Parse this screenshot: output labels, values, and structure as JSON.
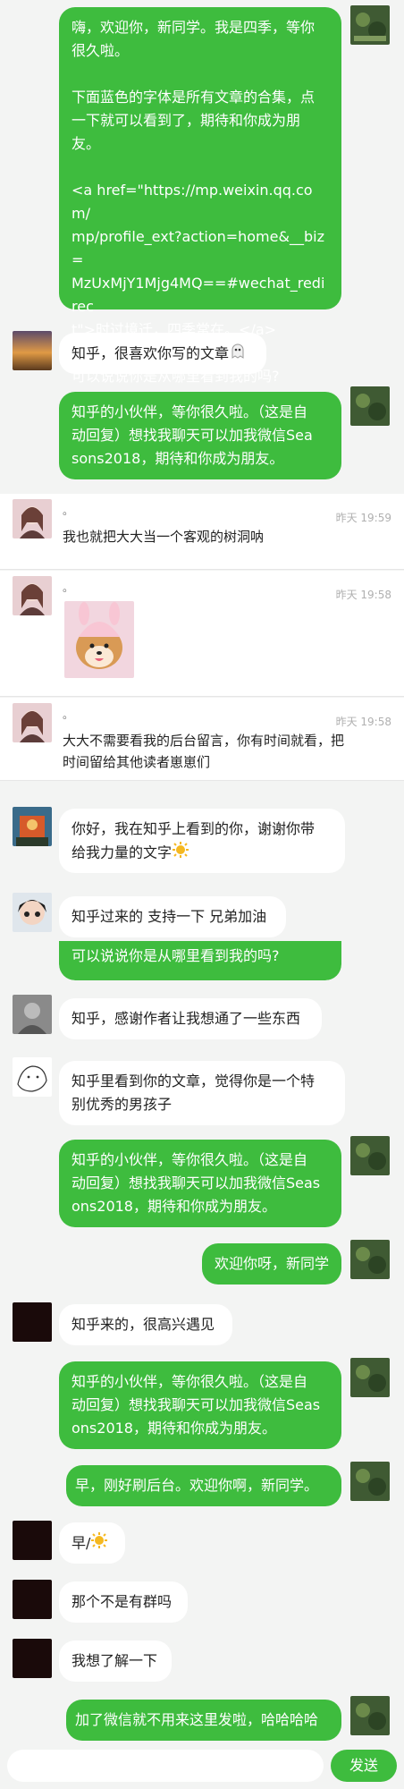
{
  "conversation": {
    "bubble1": {
      "line1": "嗨，欢迎你，新同学。我是四季，等你",
      "line2": "很久啦。",
      "line3": "下面蓝色的字体是所有文章的合集，点",
      "line4": "一下就可以看到了，期待和你成为朋",
      "line5": "友。",
      "line6": "<a href=\"https://mp.weixin.qq.com/",
      "line7": "mp/profile_ext?action=home&__biz=",
      "line8": "MzUxMjY1Mjg4MQ==#wechat_redirec",
      "line9": "t\">时过境迁，四季常在。</a>",
      "line10": "可以说说你是从哪里看到我的吗?"
    },
    "msg_zhihu_like": "知乎，很喜欢你写的文章",
    "auto_reply_1": {
      "line1": "知乎的小伙伴，等你很久啦。（这是自",
      "line2": "动回复）想找我聊天可以加我微信Sea",
      "line3": "sons2018，期待和你成为朋友。"
    },
    "comments": [
      {
        "dot": "。",
        "time": "昨天 19:59",
        "text": "我也就把大大当一个客观的树洞呐"
      },
      {
        "dot": "。",
        "time": "昨天 19:58"
      },
      {
        "dot": "。",
        "time": "昨天 19:58",
        "text1": "大大不需要看我的后台留言，你有时间就看，把",
        "text2": "时间留给其他读者崽崽们"
      }
    ],
    "msg_power": {
      "line1": "你好，我在知乎上看到的你，谢谢你带",
      "line2": "给我力量的文字"
    },
    "msg_support": "知乎过来的 支持一下 兄弟加油",
    "msg_partial": "可以说说你是从哪里看到我的吗?",
    "msg_thanks": "知乎，感谢作者让我想通了一些东西",
    "msg_outstanding": {
      "line1": "知乎里看到你的文章，觉得你是一个特",
      "line2": "别优秀的男孩子"
    },
    "auto_reply_2": {
      "line1": "知乎的小伙伴，等你很久啦。（这是自",
      "line2": "动回复）想找我聊天可以加我微信Seas",
      "line3": "ons2018，期待和你成为朋友。"
    },
    "msg_welcome": "欢迎你呀，新同学",
    "msg_happy": "知乎来的，很高兴遇见",
    "auto_reply_3": {
      "line1": "知乎的小伙伴，等你很久啦。（这是自",
      "line2": "动回复）想找我聊天可以加我微信Seas",
      "line3": "ons2018，期待和你成为朋友。"
    },
    "msg_early": "早，刚好刷后台。欢迎你啊，新同学。",
    "msg_morning": "早/",
    "msg_group": "那个不是有群吗",
    "msg_understand": "我想了解一下",
    "msg_wechat": "加了微信就不用来这里发啦，哈哈哈哈"
  },
  "input": {
    "placeholder": "",
    "send_label": "发送"
  },
  "colors": {
    "green": "#3ebc3e",
    "bg": "#f3f4f3"
  },
  "icons": [
    "plant-avatar",
    "sunset-avatar",
    "girl-avatar",
    "shiba-dog-sticker",
    "kid-avatar",
    "boy-avatar",
    "gray-photo-avatar",
    "sketch-avatar",
    "moon-avatar",
    "ghost-emoji",
    "sun-emoji"
  ]
}
